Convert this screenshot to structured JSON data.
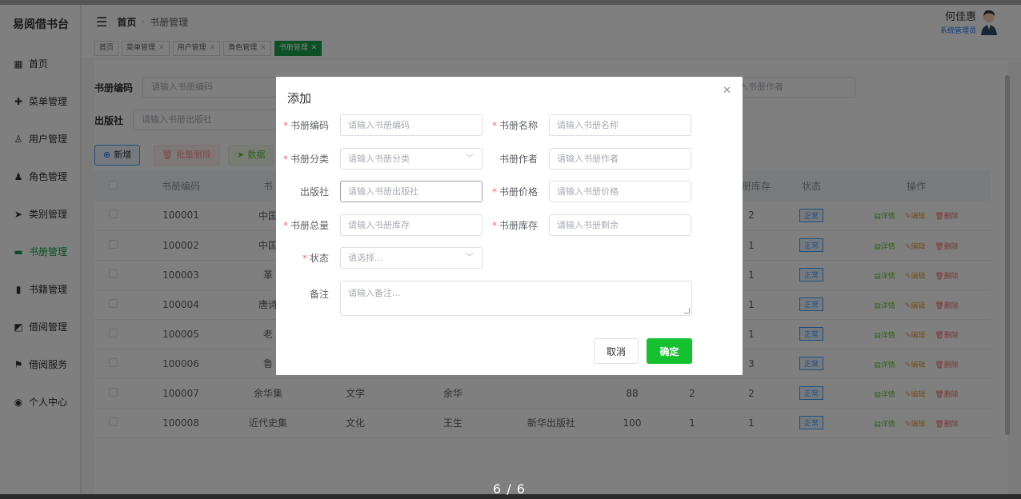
{
  "app": {
    "brand": "易阅借书台"
  },
  "sidebar": {
    "items": [
      {
        "label": "首页",
        "icon": "grid-icon"
      },
      {
        "label": "菜单管理",
        "icon": "circle-plus-icon"
      },
      {
        "label": "用户管理",
        "icon": "user-outline-icon"
      },
      {
        "label": "角色管理",
        "icon": "user-filled-icon"
      },
      {
        "label": "类别管理",
        "icon": "send-icon"
      },
      {
        "label": "书册管理",
        "icon": "monitor-icon",
        "active": true
      },
      {
        "label": "书籍管理",
        "icon": "books-icon"
      },
      {
        "label": "借阅管理",
        "icon": "chart-icon"
      },
      {
        "label": "借阅服务",
        "icon": "flag-icon"
      },
      {
        "label": "个人中心",
        "icon": "location-icon"
      }
    ]
  },
  "header": {
    "breadcrumb_home": "首页",
    "breadcrumb_current": "书册管理",
    "user_name": "何佳惠",
    "user_role": "系统管理员"
  },
  "tags": [
    {
      "label": "首页",
      "closable": false
    },
    {
      "label": "菜单管理",
      "closable": true
    },
    {
      "label": "用户管理",
      "closable": true
    },
    {
      "label": "角色管理",
      "closable": true
    },
    {
      "label": "书册管理",
      "closable": true,
      "active": true
    }
  ],
  "search": {
    "code_label": "书册编码",
    "code_placeholder": "请输入书册编码",
    "author_placeholder_visible": "输入书册作者",
    "publisher_label": "出版社",
    "publisher_placeholder": "请输入书册出版社"
  },
  "toolbar": {
    "add_label": "新增",
    "batch_delete_label": "批量删除",
    "data_label": "数据"
  },
  "table": {
    "headers": {
      "code": "书册编码",
      "name_partial": "书",
      "stock": "书册库存",
      "status": "状态",
      "ops": "操作"
    },
    "rows": [
      {
        "code": "100001",
        "name": "中国",
        "category": "",
        "author": "",
        "publisher": "",
        "price": "",
        "total": "",
        "stock": "2"
      },
      {
        "code": "100002",
        "name": "中国",
        "category": "",
        "author": "",
        "publisher": "",
        "price": "",
        "total": "",
        "stock": "1"
      },
      {
        "code": "100003",
        "name": "革",
        "category": "",
        "author": "",
        "publisher": "",
        "price": "",
        "total": "",
        "stock": "1"
      },
      {
        "code": "100004",
        "name": "唐诗",
        "category": "",
        "author": "",
        "publisher": "",
        "price": "",
        "total": "",
        "stock": "1"
      },
      {
        "code": "100005",
        "name": "老",
        "category": "",
        "author": "",
        "publisher": "",
        "price": "",
        "total": "",
        "stock": "1"
      },
      {
        "code": "100006",
        "name": "鲁",
        "category": "",
        "author": "",
        "publisher": "",
        "price": "",
        "total": "",
        "stock": "3"
      },
      {
        "code": "100007",
        "name": "余华集",
        "category": "文学",
        "author": "余华",
        "publisher": "",
        "price": "88",
        "total": "2",
        "stock": "2"
      },
      {
        "code": "100008",
        "name": "近代史集",
        "category": "文化",
        "author": "王生",
        "publisher": "新华出版社",
        "price": "100",
        "total": "1",
        "stock": "1"
      }
    ],
    "status_label": "正常",
    "op_detail": "详情",
    "op_edit": "编辑",
    "op_delete": "删除"
  },
  "pager": {
    "text": "6 / 6"
  },
  "dialog": {
    "title": "添加",
    "fields": {
      "code": {
        "label": "书册编码",
        "placeholder": "请输入书册编码",
        "required": true
      },
      "name": {
        "label": "书册名称",
        "placeholder": "请输入书册名称",
        "required": true
      },
      "category": {
        "label": "书册分类",
        "placeholder": "请输入书册分类",
        "required": true
      },
      "author": {
        "label": "书册作者",
        "placeholder": "请输入书册作者",
        "required": false
      },
      "publisher": {
        "label": "出版社",
        "placeholder": "请输入书册出版社",
        "required": false
      },
      "price": {
        "label": "书册价格",
        "placeholder": "请输入书册价格",
        "required": true
      },
      "total": {
        "label": "书册总量",
        "placeholder": "请输入书册库存",
        "required": true
      },
      "stock": {
        "label": "书册库存",
        "placeholder": "请输入书册剩余",
        "required": true
      },
      "status": {
        "label": "状态",
        "placeholder": "请选择...",
        "required": true
      },
      "remark": {
        "label": "备注",
        "placeholder": "请输入备注...",
        "required": false
      }
    },
    "required_mark": "*",
    "cancel_label": "取消",
    "ok_label": "确定"
  },
  "colors": {
    "accent": "#16a34a",
    "ok_button": "#16c12f",
    "status_blue": "#409eff"
  }
}
